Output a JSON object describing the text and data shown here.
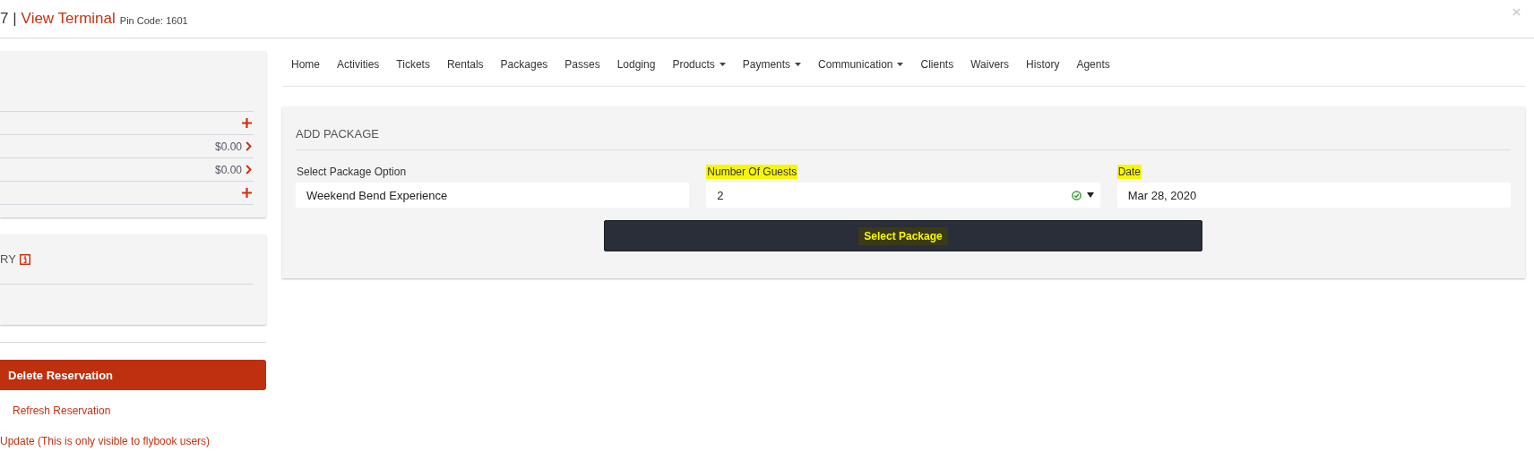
{
  "header": {
    "prefix": "7 |",
    "title": "View Terminal",
    "pin": "Pin Code: 1601"
  },
  "summary_rows": [
    {
      "kind": "add"
    },
    {
      "kind": "amount",
      "amount": "$0.00"
    },
    {
      "kind": "amount",
      "amount": "$0.00"
    },
    {
      "kind": "add"
    }
  ],
  "history_panel": {
    "title": "RY"
  },
  "actions": {
    "delete": "Delete Reservation",
    "refresh": "Refresh Reservation",
    "update_note": "Update (This is only visible to flybook users)"
  },
  "nav": [
    {
      "label": "Home",
      "dropdown": false
    },
    {
      "label": "Activities",
      "dropdown": false
    },
    {
      "label": "Tickets",
      "dropdown": false
    },
    {
      "label": "Rentals",
      "dropdown": false
    },
    {
      "label": "Packages",
      "dropdown": false
    },
    {
      "label": "Passes",
      "dropdown": false
    },
    {
      "label": "Lodging",
      "dropdown": false
    },
    {
      "label": "Products",
      "dropdown": true
    },
    {
      "label": "Payments",
      "dropdown": true
    },
    {
      "label": "Communication",
      "dropdown": true
    },
    {
      "label": "Clients",
      "dropdown": false
    },
    {
      "label": "Waivers",
      "dropdown": false
    },
    {
      "label": "History",
      "dropdown": false
    },
    {
      "label": "Agents",
      "dropdown": false
    }
  ],
  "add_package": {
    "title": "ADD PACKAGE",
    "fields": [
      {
        "label": "Select Package Option",
        "value": "Weekend Bend Experience",
        "kind": "text",
        "highlighted": false
      },
      {
        "label": "Number Of Guests",
        "value": "2",
        "kind": "select",
        "highlighted": true
      },
      {
        "label": "Date",
        "value": "Mar 28, 2020",
        "kind": "text",
        "highlighted": true
      }
    ],
    "button": "Select Package",
    "button_highlighted": true
  }
}
